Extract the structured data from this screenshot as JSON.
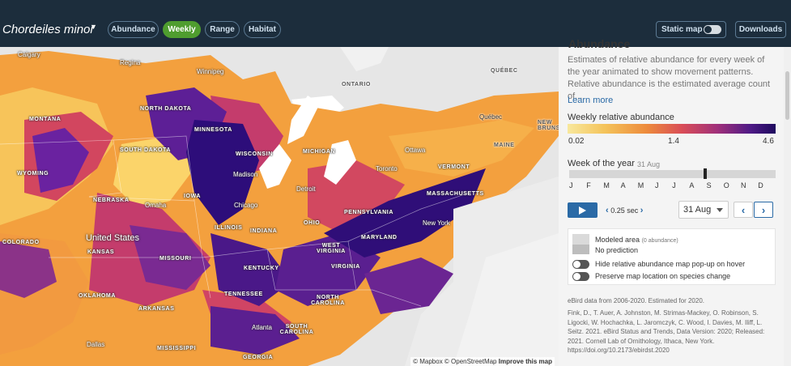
{
  "header": {
    "species": "Chordeiles minor",
    "tabs": [
      {
        "label": "Abundance"
      },
      {
        "label": "Weekly"
      },
      {
        "label": "Range"
      },
      {
        "label": "Habitat"
      }
    ],
    "static_map_label": "Static map",
    "downloads_label": "Downloads"
  },
  "map": {
    "states": [
      "NORTH DAKOTA",
      "SOUTH DAKOTA",
      "MONTANA",
      "WYOMING",
      "NEBRASKA",
      "IOWA",
      "MINNESOTA",
      "WISCONSIN",
      "MICHIGAN",
      "ILLINOIS",
      "INDIANA",
      "OHIO",
      "PENNSYLVANIA",
      "NEW YORK",
      "VERMONT",
      "MAINE",
      "MASSACHUSETTS",
      "KANSAS",
      "MISSOURI",
      "KENTUCKY",
      "WEST VIRGINIA",
      "VIRGINIA",
      "MARYLAND",
      "TENNESSEE",
      "NORTH CAROLINA",
      "SOUTH CAROLINA",
      "OKLAHOMA",
      "ARKANSAS",
      "MISSISSIPPI",
      "GEORGIA",
      "COLORADO",
      "ONTARIO",
      "QUÉBEC",
      "NEW BRUNSW"
    ],
    "cities": [
      "Calgary",
      "Regina",
      "Winnipeg",
      "Québec",
      "Ottawa",
      "Toronto",
      "Detroit",
      "Madison",
      "Chicago",
      "Omaha",
      "New York",
      "Atlanta",
      "Dallas"
    ],
    "country": "United States",
    "attribution": "© Mapbox © OpenStreetMap",
    "attribution_link": "Improve this map"
  },
  "panel": {
    "title": "Abundance",
    "description": "Estimates of relative abundance for every week of the year animated to show movement patterns. Relative abundance is the estimated average count of...",
    "learn_more": "Learn more",
    "legend_title": "Weekly relative abundance",
    "legend_min": "0.02",
    "legend_mid": "1.4",
    "legend_max": "4.6",
    "week_label": "Week of the year",
    "week_date": "31 Aug",
    "week_fraction": 0.66,
    "months": [
      "J",
      "F",
      "M",
      "A",
      "M",
      "J",
      "J",
      "A",
      "S",
      "O",
      "N",
      "D"
    ],
    "speed": "0.25 sec",
    "date_select": "31 Aug",
    "modeled_area": "Modeled area",
    "modeled_area_sub": "(0 abundance)",
    "no_prediction": "No prediction",
    "hide_popup": "Hide relative abundance map pop-up on hover",
    "preserve_location": "Preserve map location on species change",
    "ebird_data": "eBird data from 2006-2020. Estimated for 2020.",
    "citation": "Fink, D., T. Auer, A. Johnston, M. Strimas-Mackey, O. Robinson, S. Ligocki, W. Hochachka, L. Jaromczyk, C. Wood, I. Davies, M. Iliff, L. Seitz. 2021. eBird Status and Trends, Data Version: 2020; Released: 2021. Cornell Lab of Ornithology, Ithaca, New York. https://doi.org/10.2173/ebirdst.2020"
  },
  "colors": {
    "header_bg": "#1c2d3c",
    "active_tab": "#4f9d2f",
    "accent": "#2a6aa6"
  }
}
